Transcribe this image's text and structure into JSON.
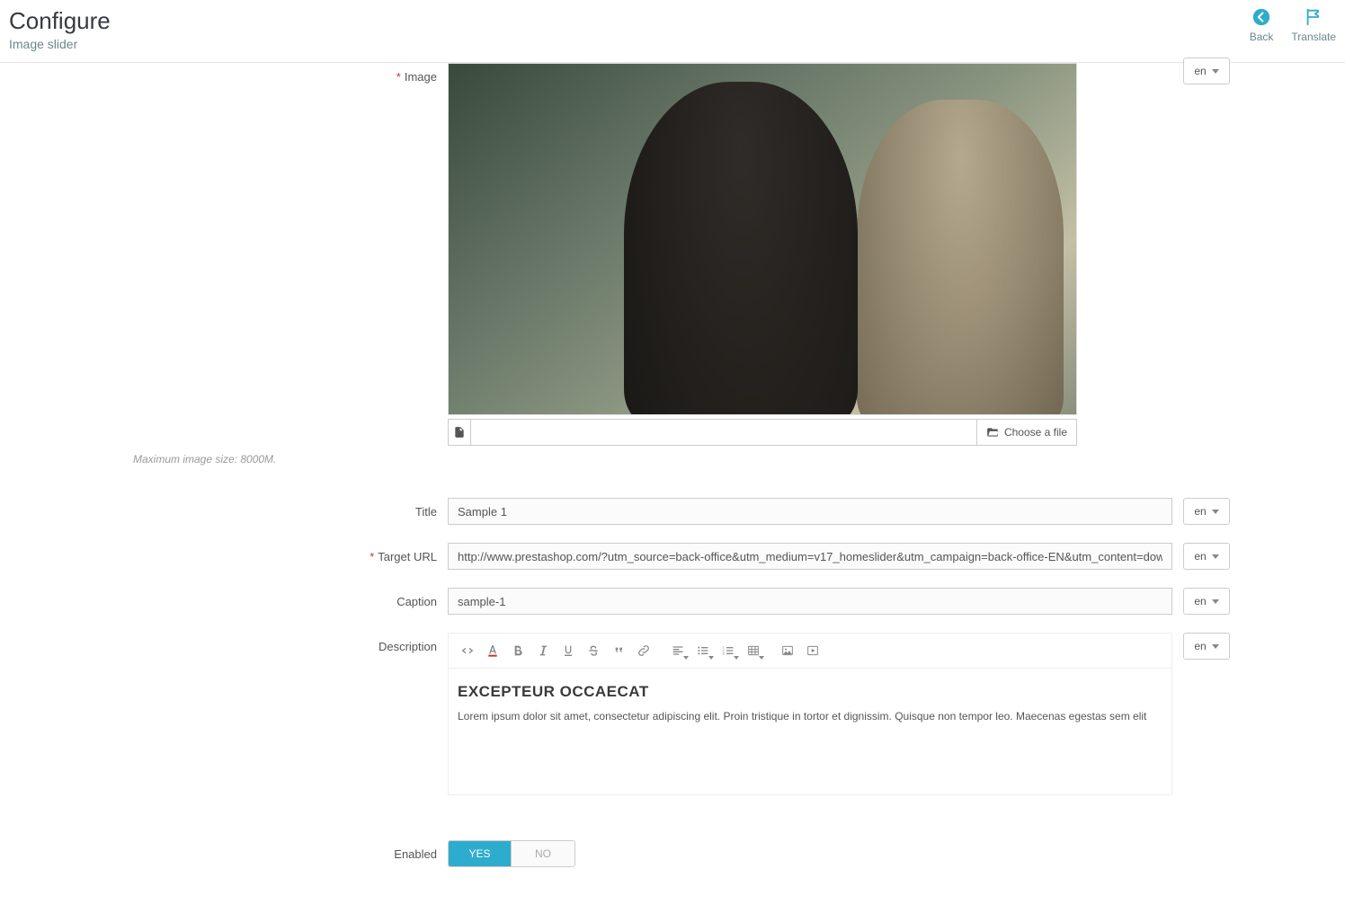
{
  "header": {
    "title": "Configure",
    "subtitle": "Image slider",
    "back_label": "Back",
    "translate_label": "Translate"
  },
  "lang": "en",
  "labels": {
    "image": "Image",
    "choose_file": "Choose a file",
    "max_size_hint": "Maximum image size: 8000M.",
    "title": "Title",
    "target_url": "Target URL",
    "caption": "Caption",
    "description": "Description",
    "enabled": "Enabled",
    "yes": "YES",
    "no": "NO"
  },
  "values": {
    "title": "Sample 1",
    "target_url": "http://www.prestashop.com/?utm_source=back-office&utm_medium=v17_homeslider&utm_campaign=back-office-EN&utm_content=download",
    "caption": "sample-1",
    "description_heading": "EXCEPTEUR OCCAECAT",
    "description_body": "Lorem ipsum dolor sit amet, consectetur adipiscing elit. Proin tristique in tortor et dignissim. Quisque non tempor leo. Maecenas egestas sem elit",
    "enabled": true
  }
}
